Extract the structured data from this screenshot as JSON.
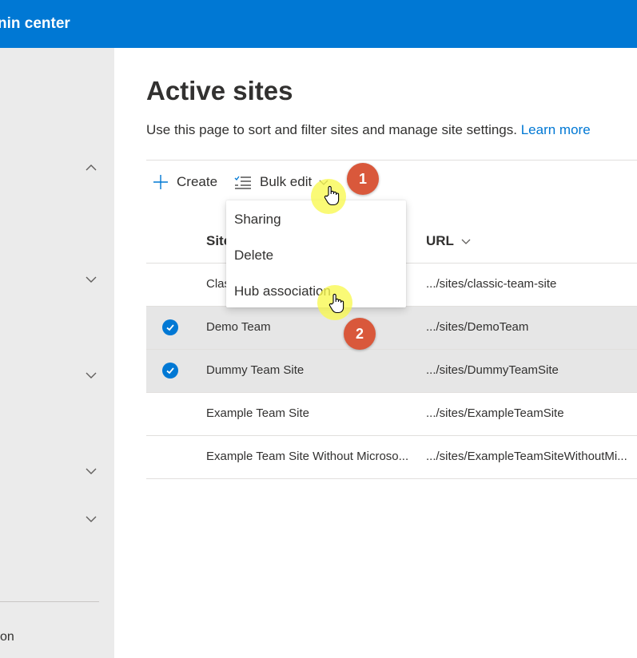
{
  "header": {
    "title": "nin center"
  },
  "sidebar": {
    "bottom_label": "on"
  },
  "page": {
    "title": "Active sites",
    "description": "Use this page to sort and filter sites and manage site settings.",
    "learn_more": "Learn more"
  },
  "commands": {
    "create": "Create",
    "bulk_edit": "Bulk edit"
  },
  "columns": {
    "site_name": "Site",
    "url": "URL"
  },
  "rows": [
    {
      "name": "Clas",
      "url": ".../sites/classic-team-site",
      "selected": false
    },
    {
      "name": "Demo Team",
      "url": ".../sites/DemoTeam",
      "selected": true
    },
    {
      "name": "Dummy Team Site",
      "url": ".../sites/DummyTeamSite",
      "selected": true
    },
    {
      "name": "Example Team Site",
      "url": ".../sites/ExampleTeamSite",
      "selected": false
    },
    {
      "name": "Example Team Site Without Microso...",
      "url": ".../sites/ExampleTeamSiteWithoutMi...",
      "selected": false
    }
  ],
  "bulk_edit_menu": [
    "Sharing",
    "Delete",
    "Hub association"
  ],
  "annotations": [
    "1",
    "2"
  ],
  "colors": {
    "accent": "#0078d4",
    "badge": "#d9583b",
    "highlight": "#f8f850"
  }
}
